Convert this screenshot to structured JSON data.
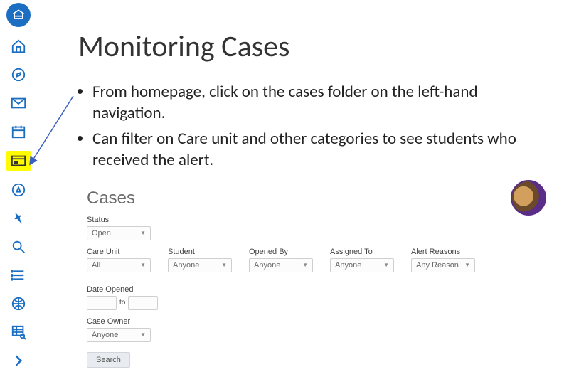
{
  "title": "Monitoring Cases",
  "bullets": [
    "From homepage, click on the cases folder on the left-hand navigation.",
    "Can filter on Care unit and other categories to see students who received the alert."
  ],
  "nav": {
    "items": [
      {
        "name": "logo"
      },
      {
        "name": "home"
      },
      {
        "name": "compass"
      },
      {
        "name": "mail"
      },
      {
        "name": "calendar"
      },
      {
        "name": "cases-folder",
        "highlighted": true
      },
      {
        "name": "target"
      },
      {
        "name": "pin"
      },
      {
        "name": "search"
      },
      {
        "name": "list"
      },
      {
        "name": "globe"
      },
      {
        "name": "grid-search"
      },
      {
        "name": "next"
      }
    ]
  },
  "cases": {
    "heading": "Cases",
    "filters_row1": [
      {
        "label": "Status",
        "value": "Open"
      }
    ],
    "filters_row2": [
      {
        "label": "Care Unit",
        "value": "All"
      },
      {
        "label": "Student",
        "value": "Anyone"
      },
      {
        "label": "Opened By",
        "value": "Anyone"
      },
      {
        "label": "Assigned To",
        "value": "Anyone"
      },
      {
        "label": "Alert Reasons",
        "value": "Any Reason"
      }
    ],
    "date_opened_label": "Date Opened",
    "date_to_label": "to",
    "filters_row3": [
      {
        "label": "Case Owner",
        "value": "Anyone"
      }
    ],
    "search_label": "Search"
  }
}
